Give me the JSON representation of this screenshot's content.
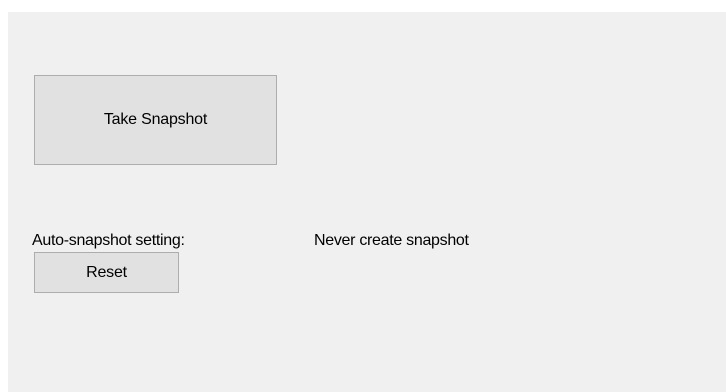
{
  "window": {
    "background": "#f0f0f0"
  },
  "buttons": {
    "take_snapshot_label": "Take Snapshot",
    "reset_label": "Reset"
  },
  "auto_snapshot": {
    "label": "Auto-snapshot setting:",
    "value": "Never create snapshot"
  }
}
